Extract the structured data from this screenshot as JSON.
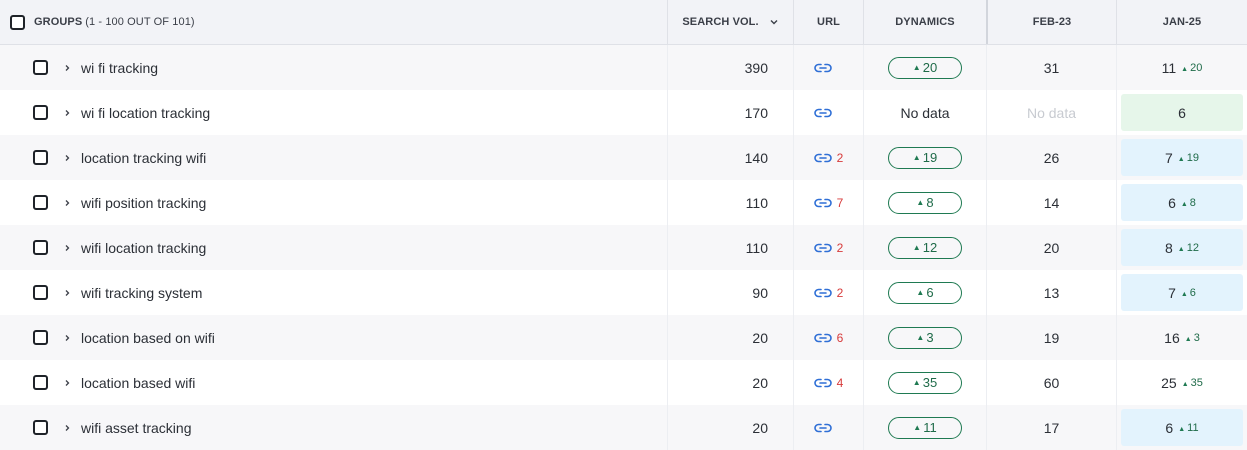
{
  "header": {
    "groups_label": "GROUPS",
    "groups_count": "(1 - 100 OUT OF 101)",
    "search_vol": "SEARCH VOL.",
    "url": "URL",
    "dynamics": "DYNAMICS",
    "feb": "FEB-23",
    "jan": "JAN-25"
  },
  "rows": [
    {
      "keyword": "wi fi tracking",
      "volume": "390",
      "url_count": "",
      "dynamics": "20",
      "feb": "31",
      "jan": "11",
      "jan_delta": "20",
      "jan_highlight": "none"
    },
    {
      "keyword": "wi fi location tracking",
      "volume": "170",
      "url_count": "",
      "dynamics_text": "No data",
      "feb_text": "No data",
      "jan": "6",
      "jan_delta": "",
      "jan_highlight": "green"
    },
    {
      "keyword": "location tracking wifi",
      "volume": "140",
      "url_count": "2",
      "dynamics": "19",
      "feb": "26",
      "jan": "7",
      "jan_delta": "19",
      "jan_highlight": "blue"
    },
    {
      "keyword": "wifi position tracking",
      "volume": "110",
      "url_count": "7",
      "dynamics": "8",
      "feb": "14",
      "jan": "6",
      "jan_delta": "8",
      "jan_highlight": "blue"
    },
    {
      "keyword": "wifi location tracking",
      "volume": "110",
      "url_count": "2",
      "dynamics": "12",
      "feb": "20",
      "jan": "8",
      "jan_delta": "12",
      "jan_highlight": "blue"
    },
    {
      "keyword": "wifi tracking system",
      "volume": "90",
      "url_count": "2",
      "dynamics": "6",
      "feb": "13",
      "jan": "7",
      "jan_delta": "6",
      "jan_highlight": "blue"
    },
    {
      "keyword": "location based on wifi",
      "volume": "20",
      "url_count": "6",
      "dynamics": "3",
      "feb": "19",
      "jan": "16",
      "jan_delta": "3",
      "jan_highlight": "none"
    },
    {
      "keyword": "location based wifi",
      "volume": "20",
      "url_count": "4",
      "dynamics": "35",
      "feb": "60",
      "jan": "25",
      "jan_delta": "35",
      "jan_highlight": "none"
    },
    {
      "keyword": "wifi asset tracking",
      "volume": "20",
      "url_count": "",
      "dynamics": "11",
      "feb": "17",
      "jan": "6",
      "jan_delta": "11",
      "jan_highlight": "blue"
    }
  ],
  "colors": {
    "positive": "#1f7a52",
    "url_count": "#d73a3a",
    "link": "#2f6fd6",
    "highlight_blue": "#e3f3fd",
    "highlight_green": "#e6f6ea"
  },
  "icons": {
    "checkbox": "checkbox-icon",
    "sort": "chevron-down-icon",
    "expand": "chevron-right-icon",
    "url": "link-icon",
    "up": "triangle-up-icon"
  }
}
